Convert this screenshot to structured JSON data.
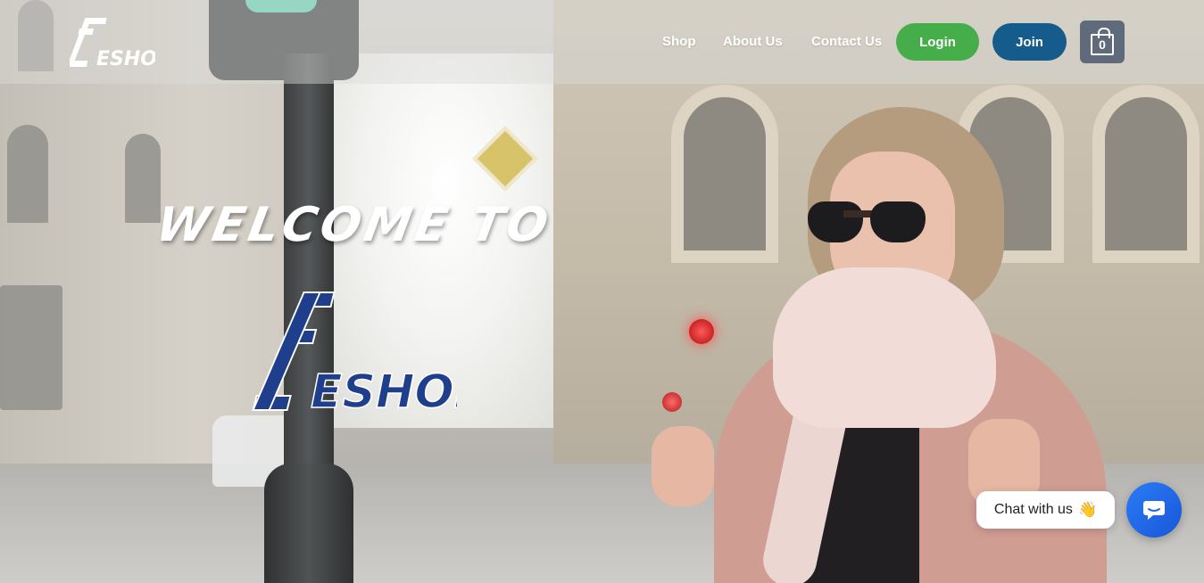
{
  "brand": {
    "logo_text": "ESHOP",
    "logo_color": "#1f3f8c"
  },
  "nav": {
    "links": [
      {
        "label": "Shop"
      },
      {
        "label": "About Us"
      },
      {
        "label": "Contact Us"
      }
    ],
    "login_label": "Login",
    "join_label": "Join",
    "cart_count": "0",
    "login_color": "#45ad4a",
    "join_color": "#155b8c"
  },
  "hero": {
    "welcome_text": "WELCOME TO",
    "logo_text": "ESHOP"
  },
  "chat": {
    "bubble_text": "Chat with us",
    "bubble_emoji": "👋",
    "button_icon": "chat-icon",
    "button_color": "#1f6ae8"
  }
}
